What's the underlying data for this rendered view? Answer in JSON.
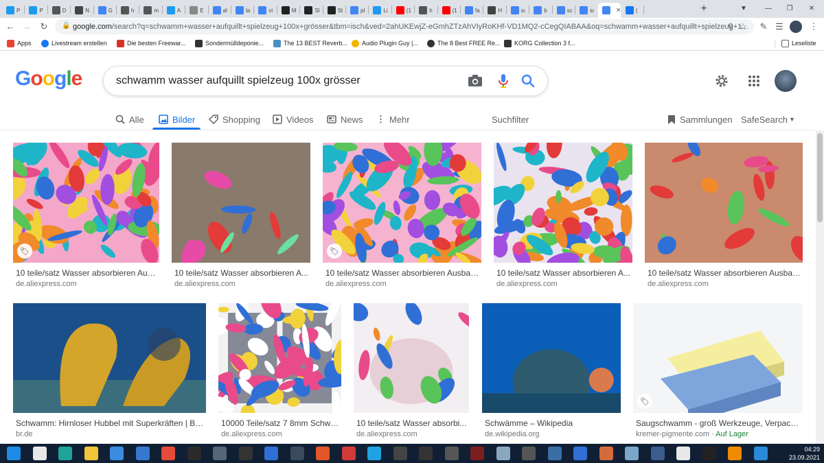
{
  "browser": {
    "tabs": [
      {
        "label": "P",
        "color": "#1d9bf0"
      },
      {
        "label": "P",
        "color": "#1d9bf0"
      },
      {
        "label": "D",
        "color": "#555555"
      },
      {
        "label": "N",
        "color": "#444444"
      },
      {
        "label": "G",
        "color": "#4285f4"
      },
      {
        "label": "h",
        "color": "#555555"
      },
      {
        "label": "m",
        "color": "#555555"
      },
      {
        "label": "A",
        "color": "#1d9bf0"
      },
      {
        "label": "E",
        "color": "#888888"
      },
      {
        "label": "al",
        "color": "#4285f4"
      },
      {
        "label": "la",
        "color": "#4285f4"
      },
      {
        "label": "vi",
        "color": "#4285f4"
      },
      {
        "label": "M",
        "color": "#222222"
      },
      {
        "label": "Sl",
        "color": "#222222"
      },
      {
        "label": "St",
        "color": "#222222"
      },
      {
        "label": "pl",
        "color": "#4285f4"
      },
      {
        "label": "Li",
        "color": "#1d9bf0"
      },
      {
        "label": "(1",
        "color": "#ff0000"
      },
      {
        "label": "h",
        "color": "#555555"
      },
      {
        "label": "(1",
        "color": "#ff0000"
      },
      {
        "label": "fa",
        "color": "#4285f4"
      },
      {
        "label": "H",
        "color": "#444444"
      },
      {
        "label": "sı",
        "color": "#4285f4"
      },
      {
        "label": "b",
        "color": "#4285f4"
      },
      {
        "label": "sc",
        "color": "#4285f4"
      },
      {
        "label": "sı",
        "color": "#4285f4"
      },
      {
        "label": "",
        "color": "#4285f4"
      },
      {
        "label": "(",
        "color": "#1877f2"
      }
    ],
    "new_tab": "+",
    "url_host": "google.com",
    "url_rest": "/search?q=schwamm+wasser+aufquillt+spielzeug+100x+grösser&tbm=isch&ved=2ahUKEwjZ-eGmhZTzAhVIyRoKHf-VD1MQ2-cCegQIABAA&oq=schwamm+wasser+aufquillt+spielzeug+1..."
  },
  "bookmarks": {
    "items": [
      {
        "label": "Apps",
        "color": "#ea4335"
      },
      {
        "label": "Livestream erstellen",
        "color": "#1877f2"
      },
      {
        "label": "Die besten Freewar...",
        "color": "#d93025"
      },
      {
        "label": "Sondermülldeponie...",
        "color": "#333333"
      },
      {
        "label": "The 13 BEST Reverb...",
        "color": "#4a90c2"
      },
      {
        "label": "Audio Plugin Guy |...",
        "color": "#333333"
      },
      {
        "label": "The 8 Best FREE Re...",
        "color": "#333333"
      },
      {
        "label": "KORG Collection 3 f...",
        "color": "#333333"
      }
    ],
    "reading_list": "Leseliste"
  },
  "search": {
    "query": "schwamm wasser aufquillt spielzeug 100x grösser"
  },
  "nav": {
    "tabs": [
      {
        "label": "Alle",
        "icon": "search-icon"
      },
      {
        "label": "Bilder",
        "icon": "image-icon"
      },
      {
        "label": "Shopping",
        "icon": "tag-icon"
      },
      {
        "label": "Videos",
        "icon": "play-icon"
      },
      {
        "label": "News",
        "icon": "news-icon"
      },
      {
        "label": "Mehr",
        "icon": "more-vert-icon"
      }
    ],
    "tools": "Suchfilter",
    "collections": "Sammlungen",
    "safesearch": "SafeSearch"
  },
  "results": [
    {
      "title": "10 teile/satz Wasser absorbieren Aus...",
      "source": "de.aliexpress.com",
      "badge": true
    },
    {
      "title": "10 teile/satz Wasser absorbieren A...",
      "source": "de.aliexpress.com",
      "badge": false
    },
    {
      "title": "10 teile/satz Wasser absorbieren Ausbau ...",
      "source": "de.aliexpress.com",
      "badge": true
    },
    {
      "title": "10 teile/satz Wasser absorbieren A...",
      "source": "de.aliexpress.com",
      "badge": false
    },
    {
      "title": "10 teile/satz Wasser absorbieren Ausbau...",
      "source": "de.aliexpress.com",
      "badge": false
    },
    {
      "title": "Schwamm: Hirnloser Hubbel mit Superkräften | BR ...",
      "source": "br.de",
      "badge": false
    },
    {
      "title": "10000 Teile/satz 7 8mm Schwa...",
      "source": "de.aliexpress.com",
      "badge": false
    },
    {
      "title": "10 teile/satz Wasser absorbi...",
      "source": "de.aliexpress.com",
      "badge": false
    },
    {
      "title": "Schwämme – Wikipedia",
      "source": "de.wikipedia.org",
      "badge": false
    },
    {
      "title": "Saugschwamm - groß Werkzeuge, Verpacku...",
      "source": "kremer-pigmente.com",
      "stock": "Auf Lager",
      "badge": true
    }
  ],
  "taskbar": {
    "time": "04:29",
    "date": "23.09.2021"
  }
}
